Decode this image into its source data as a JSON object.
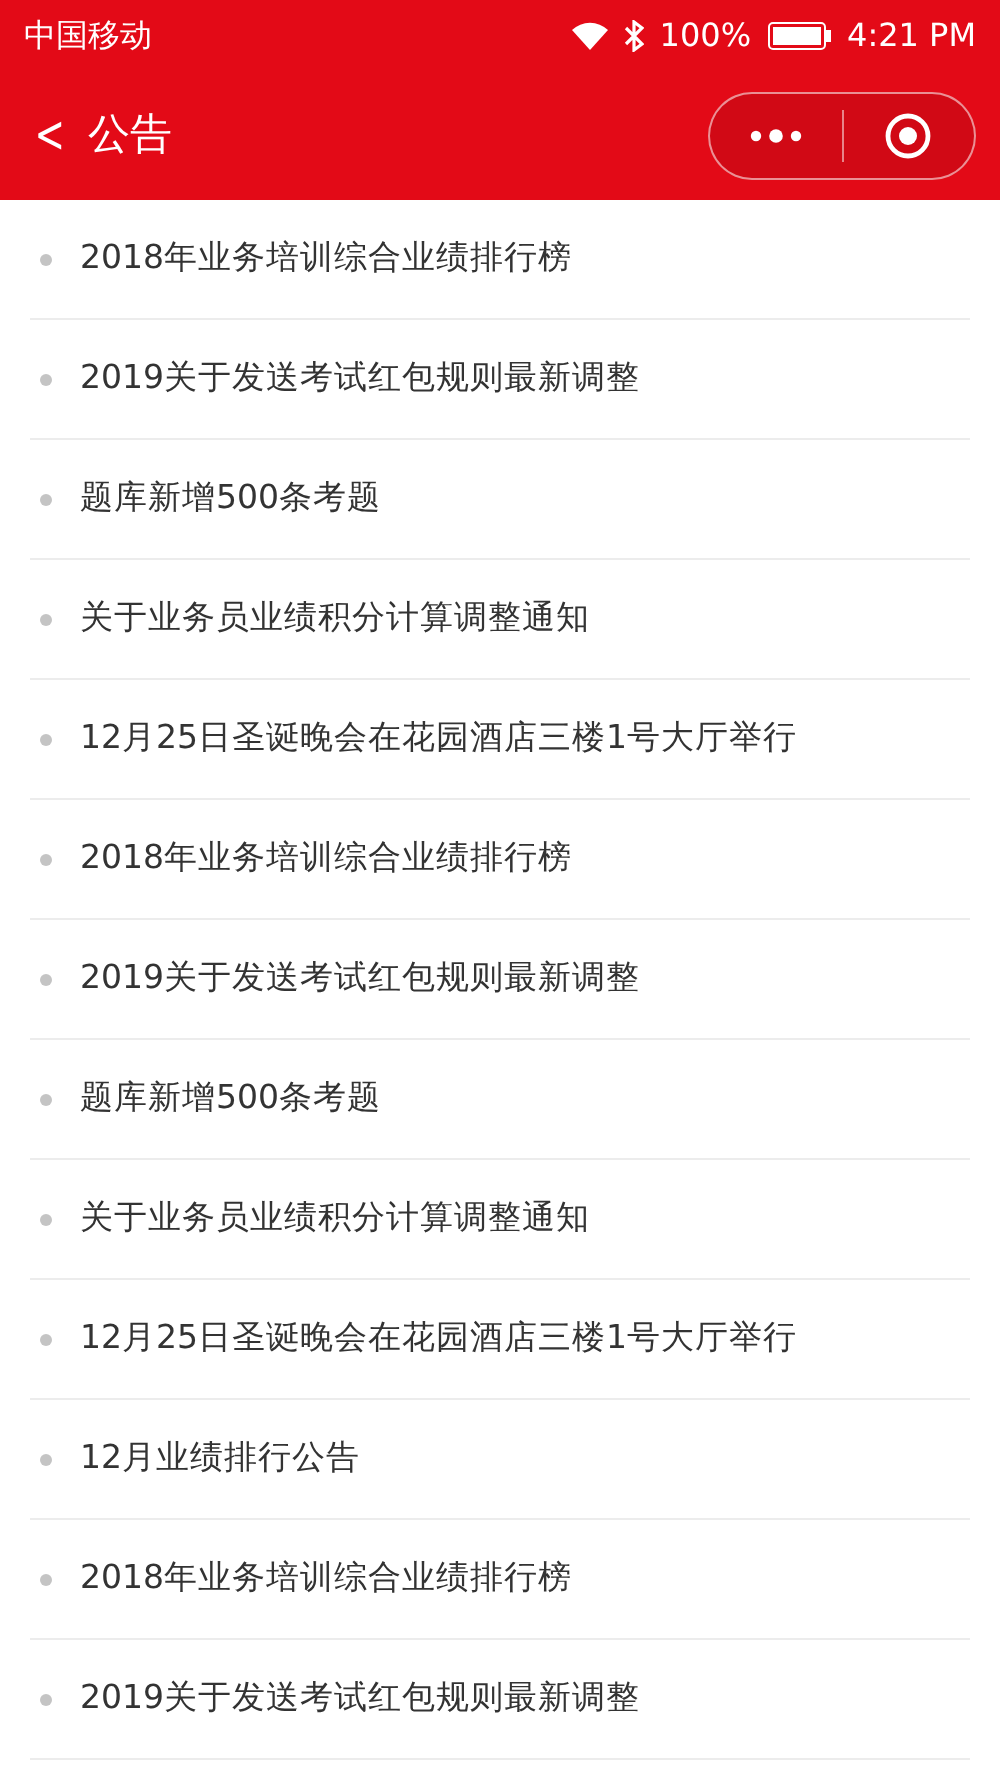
{
  "status_bar": {
    "carrier": "中国移动",
    "battery": "100%",
    "time": "4:21 PM"
  },
  "header": {
    "back": "<",
    "title": "公告"
  },
  "notices": [
    {
      "title": "2018年业务培训综合业绩排行榜"
    },
    {
      "title": "2019关于发送考试红包规则最新调整"
    },
    {
      "title": "题库新增500条考题"
    },
    {
      "title": "关于业务员业绩积分计算调整通知"
    },
    {
      "title": "12月25日圣诞晚会在花园酒店三楼1号大厅举行"
    },
    {
      "title": "2018年业务培训综合业绩排行榜"
    },
    {
      "title": "2019关于发送考试红包规则最新调整"
    },
    {
      "title": "题库新增500条考题"
    },
    {
      "title": "关于业务员业绩积分计算调整通知"
    },
    {
      "title": "12月25日圣诞晚会在花园酒店三楼1号大厅举行"
    },
    {
      "title": "12月业绩排行公告"
    },
    {
      "title": "2018年业务培训综合业绩排行榜"
    },
    {
      "title": "2019关于发送考试红包规则最新调整"
    }
  ]
}
